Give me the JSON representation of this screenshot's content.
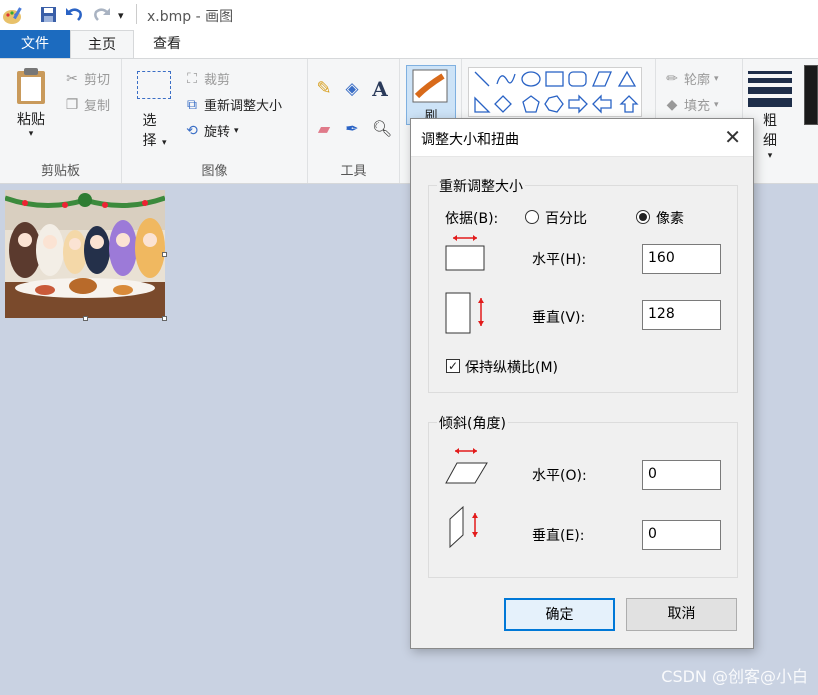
{
  "app": {
    "title": "x.bmp - 画图"
  },
  "quick_access": {
    "app_icon": "paint-palette-icon",
    "save_icon": "save-icon",
    "undo_icon": "undo-icon",
    "redo_icon": "redo-icon",
    "dropdown": "▾"
  },
  "tabs": [
    {
      "label": "文件"
    },
    {
      "label": "主页"
    },
    {
      "label": "查看"
    }
  ],
  "ribbon": {
    "clipboard": {
      "paste": "粘贴",
      "cut": "剪切",
      "copy": "复制",
      "label": "剪贴板"
    },
    "image": {
      "select": "选择",
      "crop": "裁剪",
      "resize": "重新调整大小",
      "rotate": "旋转",
      "label": "图像"
    },
    "tools": {
      "label": "工具"
    },
    "brush": {
      "label": "刷"
    },
    "shapes": {
      "outline": "轮廓",
      "fill": "填充"
    },
    "size": {
      "label": "粗细"
    }
  },
  "dialog": {
    "title": "调整大小和扭曲",
    "close": "✕",
    "resize_section": {
      "legend": "重新调整大小",
      "by_label": "依据(B):",
      "percent_label": "百分比",
      "pixels_label": "像素",
      "selected": "pixels",
      "horizontal_label": "水平(H):",
      "horizontal_value": "160",
      "vertical_label": "垂直(V):",
      "vertical_value": "128",
      "keep_ratio_label": "保持纵横比(M)",
      "keep_ratio_checked": true
    },
    "skew_section": {
      "legend": "倾斜(角度)",
      "horizontal_label": "水平(O):",
      "horizontal_value": "0",
      "vertical_label": "垂直(E):",
      "vertical_value": "0"
    },
    "ok": "确定",
    "cancel": "取消"
  },
  "watermark": "CSDN @创客@小白",
  "colors": {
    "accent": "#1c6bbf",
    "canvas_bg": "#c9d2e2",
    "dialog_bg": "#f0f0f0",
    "arrow_red": "#e21b1b"
  }
}
